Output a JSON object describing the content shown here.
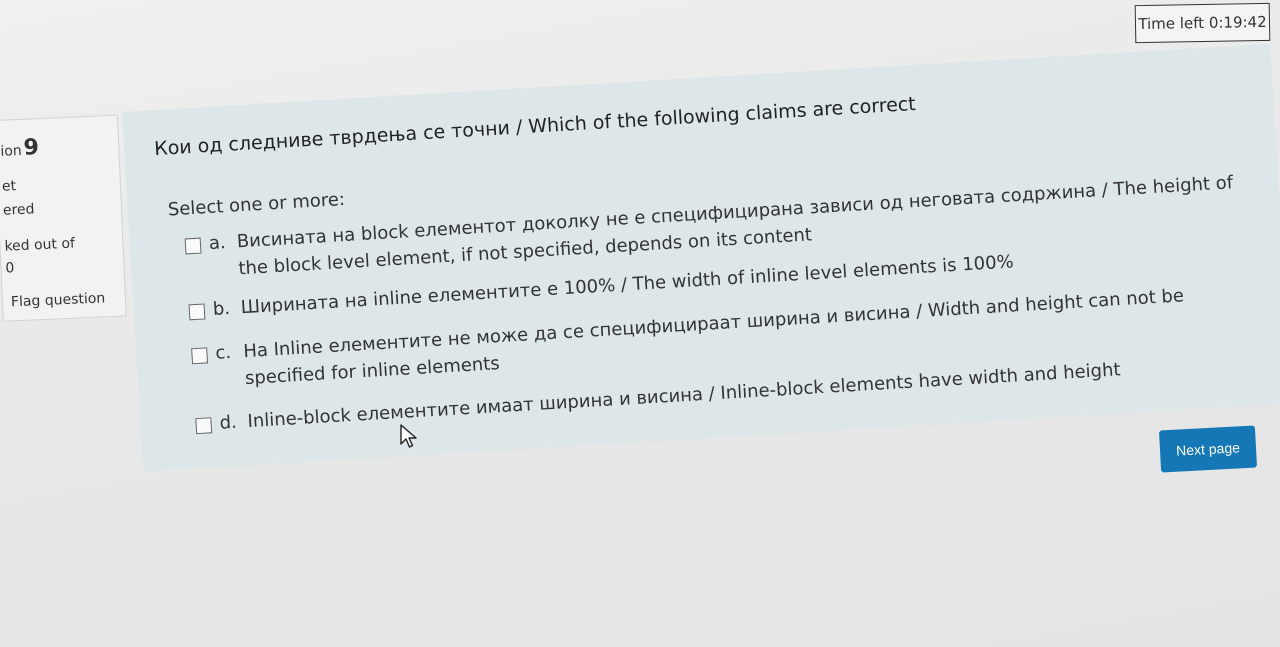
{
  "timer": {
    "text": "Time left 0:19:42"
  },
  "info": {
    "question_prefix": "ion",
    "question_number": "9",
    "status_line1": "et",
    "status_line2": "ered",
    "marked_line1": "ked out of",
    "marked_line2": "0",
    "flag_label": "Flag question"
  },
  "question": {
    "text": "Кои од следниве тврдења се точни / Which of the following claims are correct",
    "prompt": "Select one or more:",
    "options": [
      {
        "letter": "a.",
        "text": "Висината на block елементот доколку не е специфицирана зависи од неговата содржина / The height of the block level element, if not specified, depends on its content",
        "checked": false
      },
      {
        "letter": "b.",
        "text": "Ширината на inline елементите е 100% / The width of inline level elements is 100%",
        "checked": false
      },
      {
        "letter": "c.",
        "text": "На Inline елементите не може да се специфицираат ширина и висина / Width and height can not be specified for inline elements",
        "checked": false
      },
      {
        "letter": "d.",
        "text": "Inline-block елементите имаат ширина и висина / Inline-block elements have width and height",
        "checked": false
      }
    ]
  },
  "navigation": {
    "next_label": "Next page"
  },
  "colors": {
    "accent": "#1577b6",
    "question_bg": "#dde6e9"
  },
  "icons": {
    "pointer": "mouse-pointer-icon"
  }
}
